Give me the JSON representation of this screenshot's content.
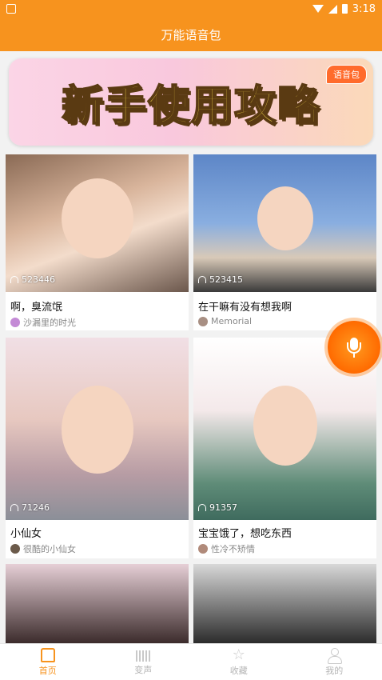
{
  "status_bar": {
    "time": "3:18",
    "icons": [
      "notification-icon",
      "wifi-icon",
      "signal-icon",
      "battery-icon"
    ]
  },
  "header": {
    "title": "万能语音包"
  },
  "banner": {
    "title": "新手使用攻略",
    "badge": "语音包"
  },
  "cards": [
    {
      "plays": "523446",
      "title": "啊，臭流氓",
      "author": "沙漏里的时光",
      "avatar_color": "#c48ad6"
    },
    {
      "plays": "523415",
      "title": "在干嘛有没有想我啊",
      "author": "Memorial",
      "avatar_color": "#a88f83"
    },
    {
      "plays": "71246",
      "title": "小仙女",
      "author": "很酷的小仙女",
      "avatar_color": "#6b5a4a"
    },
    {
      "plays": "91357",
      "title": "宝宝饿了，想吃东西",
      "author": "性冷不矫情",
      "avatar_color": "#b08a7a"
    },
    {
      "plays": "",
      "title": "",
      "author": "",
      "avatar_color": ""
    },
    {
      "plays": "",
      "title": "",
      "author": "",
      "avatar_color": ""
    }
  ],
  "fab": {
    "icon": "microphone-icon"
  },
  "bottom_nav": [
    {
      "label": "首页",
      "icon": "home-icon",
      "active": true
    },
    {
      "label": "变声",
      "icon": "voice-change-icon",
      "active": false
    },
    {
      "label": "收藏",
      "icon": "star-icon",
      "active": false
    },
    {
      "label": "我的",
      "icon": "user-icon",
      "active": false
    }
  ],
  "colors": {
    "accent": "#f7931e",
    "fab": "#ff6a00",
    "inactive": "#b5b5b5"
  }
}
